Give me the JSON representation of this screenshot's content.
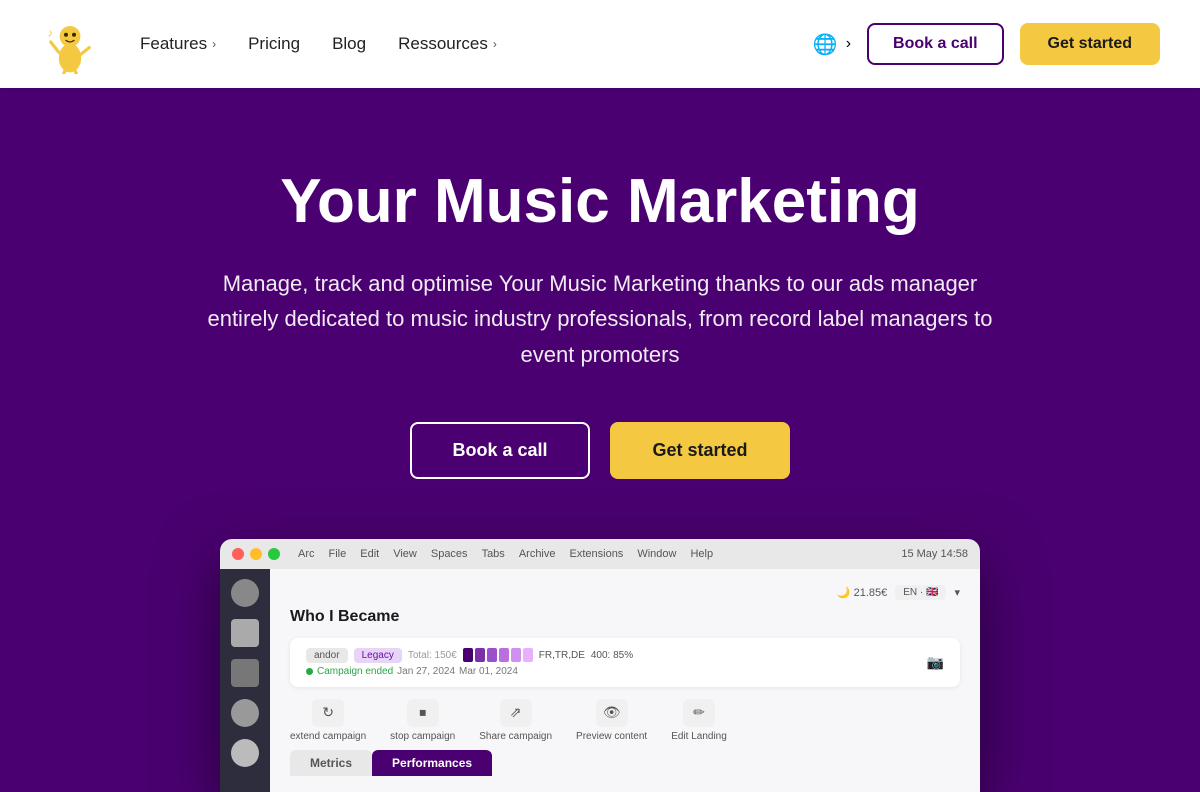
{
  "nav": {
    "logo_alt": "Music marketing mascot",
    "links": [
      {
        "label": "Features",
        "has_chevron": true
      },
      {
        "label": "Pricing",
        "has_chevron": false
      },
      {
        "label": "Blog",
        "has_chevron": false
      },
      {
        "label": "Ressources",
        "has_chevron": true
      }
    ],
    "lang_icon": "🌐",
    "lang_chevron": "›",
    "book_call_label": "Book a call",
    "get_started_label": "Get started"
  },
  "hero": {
    "title": "Your Music Marketing",
    "subtitle": "Manage, track and optimise Your Music Marketing thanks to our ads manager entirely dedicated to music industry professionals, from record label managers to event promoters",
    "cta_book": "Book a call",
    "cta_start": "Get started"
  },
  "mockup": {
    "menubar_items": [
      "Arc",
      "File",
      "Edit",
      "View",
      "Spaces",
      "Tabs",
      "Archive",
      "Extensions",
      "Window",
      "Help"
    ],
    "top_right": "15 May  14:58",
    "balance": "21.85 €",
    "lang": "EN",
    "campaign_title": "Who I Became",
    "campaign_badge1": "andor",
    "campaign_badge2": "Legacy",
    "progress_colors": [
      "#4a0070",
      "#7b2fa8",
      "#9b4fc8",
      "#b870e0",
      "#d090f0",
      "#e8b0ff"
    ],
    "progress_text": "FR,TR,DE",
    "progress_subtext": "400: 85%",
    "campaign_ended": "Campaign ended",
    "campaign_date": "Jan 27, 2024",
    "campaign_end_date": "Mar 01, 2024",
    "actions": [
      {
        "icon": "↻",
        "label": "extend campaign"
      },
      {
        "icon": "⏹",
        "label": "stop campaign"
      },
      {
        "icon": "⇗",
        "label": "Share campaign"
      },
      {
        "icon": "👁",
        "label": "Preview content"
      },
      {
        "icon": "✏",
        "label": "Edit Landing"
      }
    ],
    "tab_metrics": "Metrics",
    "tab_performances": "Performances",
    "total_label": "Total: 150€"
  }
}
